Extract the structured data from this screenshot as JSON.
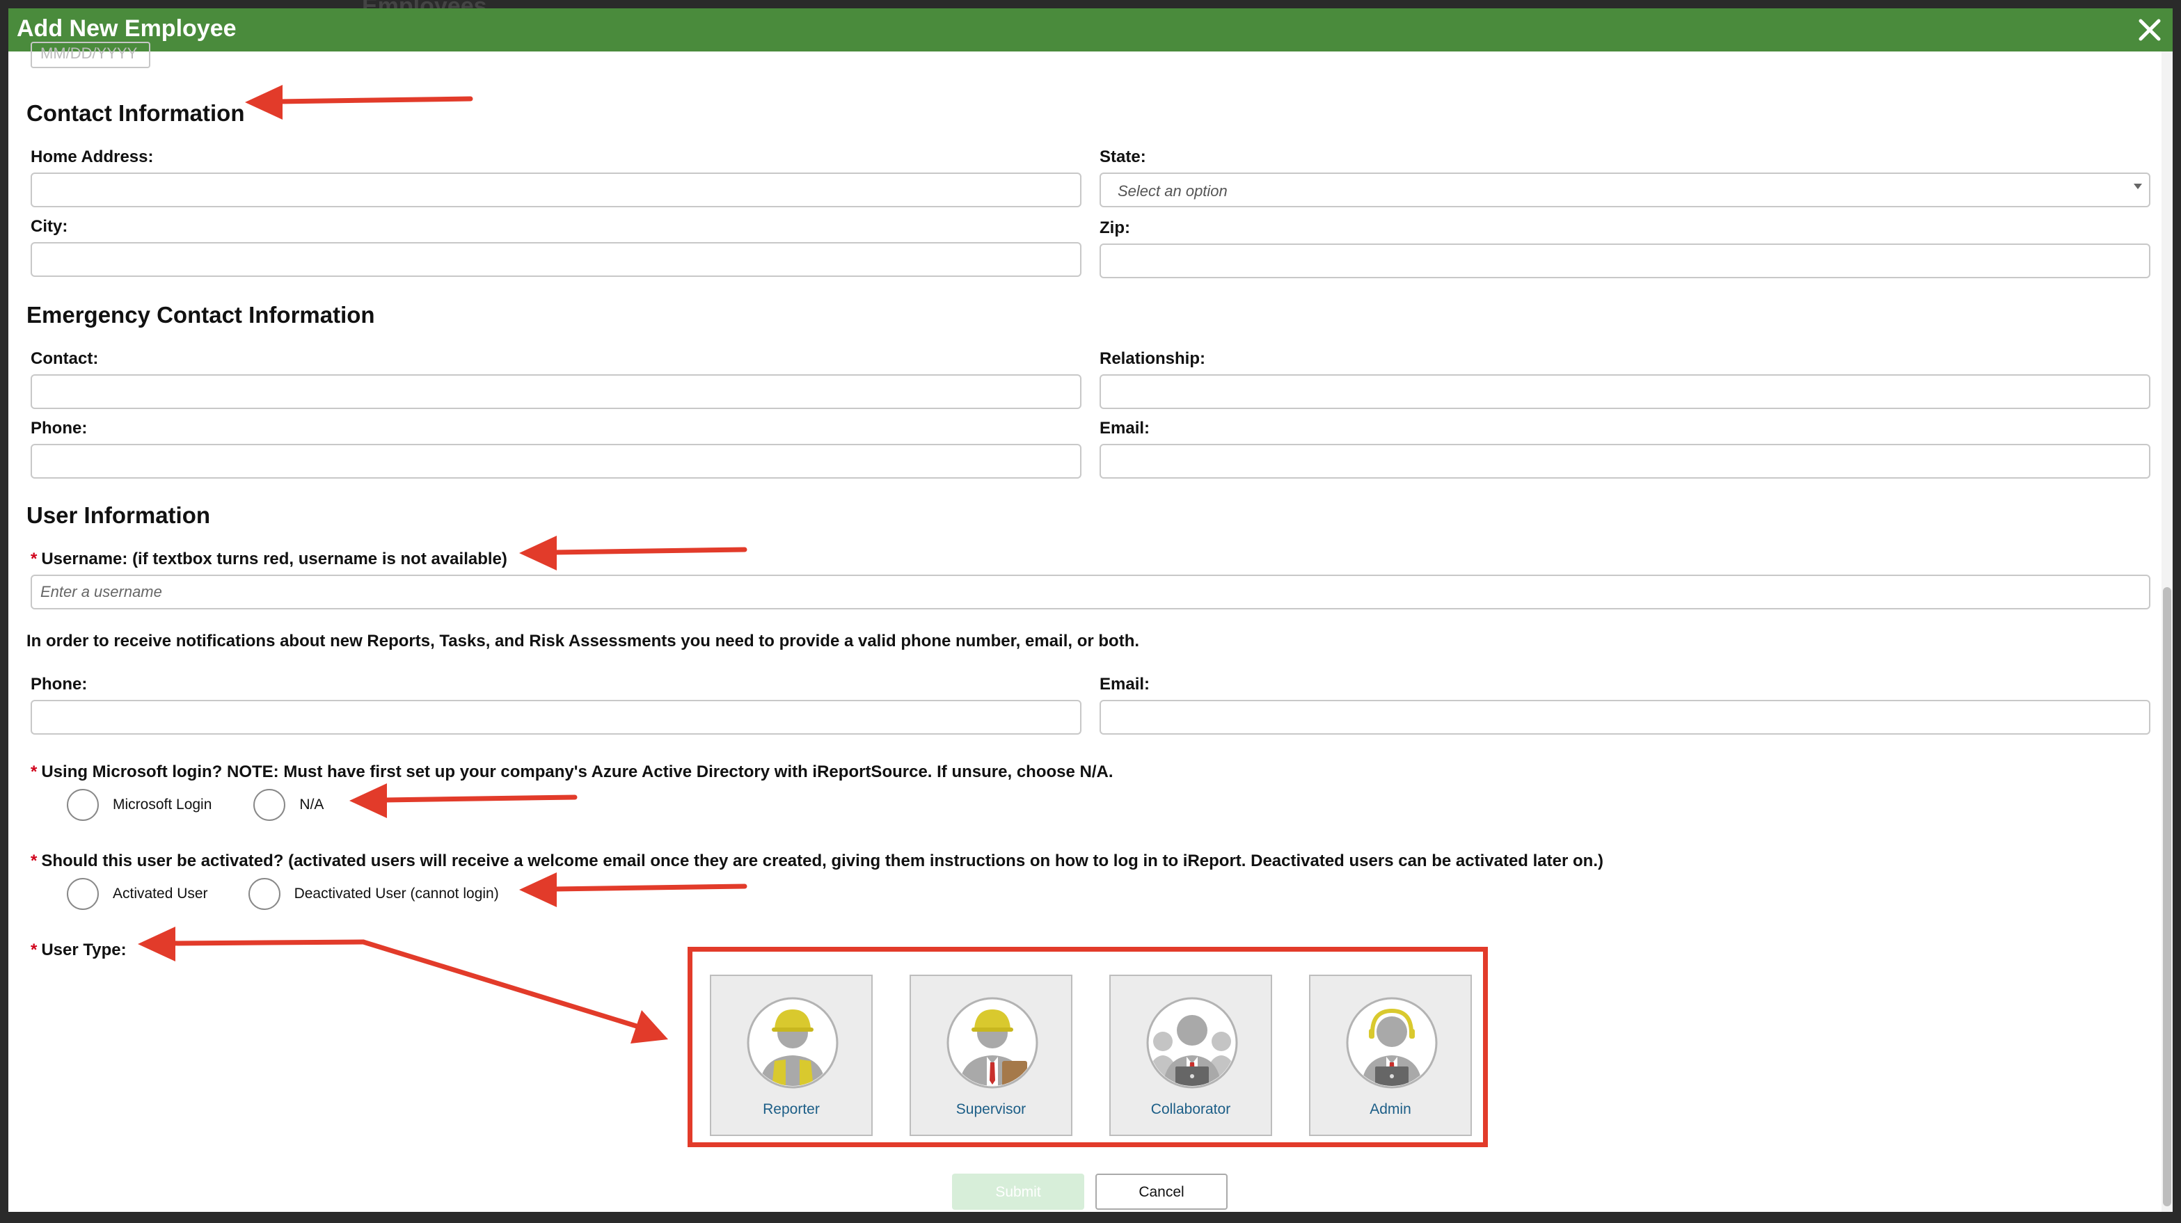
{
  "background": {
    "page_title": "Employees"
  },
  "modal": {
    "title": "Add New Employee",
    "header_color": "#4a8b3c",
    "close_icon": "close-icon"
  },
  "dob": {
    "placeholder": "MM/DD/YYYY"
  },
  "contact": {
    "title": "Contact Information",
    "home_address_label": "Home Address:",
    "state_label": "State:",
    "state_value": "Select an option",
    "city_label": "City:",
    "zip_label": "Zip:"
  },
  "emergency": {
    "title": "Emergency Contact Information",
    "contact_label": "Contact:",
    "relationship_label": "Relationship:",
    "phone_label": "Phone:",
    "email_label": "Email:"
  },
  "user_info": {
    "title": "User Information",
    "username_label": "Username: (if textbox turns red, username is not available)",
    "username_placeholder": "Enter a username",
    "notice": "In order to receive notifications about new Reports, Tasks, and Risk Assessments you need to provide a valid phone number, email, or both.",
    "phone_label": "Phone:",
    "email_label": "Email:",
    "microsoft_label": "Using Microsoft login? NOTE: Must have first set up your company's Azure Active Directory with iReportSource. If unsure, choose N/A.",
    "microsoft_options": [
      "Microsoft Login",
      "N/A"
    ],
    "activation_label": "Should this user be activated? (activated users will receive a welcome email once they are created, giving them instructions on how to log in to iReport. Deactivated users can be activated later on.)",
    "activation_options": [
      "Activated User",
      "Deactivated User (cannot login)"
    ],
    "user_type_label": "User Type:",
    "user_types": [
      {
        "label": "Reporter",
        "icon": "reporter-icon"
      },
      {
        "label": "Supervisor",
        "icon": "supervisor-icon"
      },
      {
        "label": "Collaborator",
        "icon": "collaborator-icon"
      },
      {
        "label": "Admin",
        "icon": "admin-icon"
      }
    ],
    "required_marker": "*"
  },
  "actions": {
    "submit_label": "Submit",
    "cancel_label": "Cancel"
  },
  "annotations": {
    "arrow_color": "#e23b2a"
  }
}
